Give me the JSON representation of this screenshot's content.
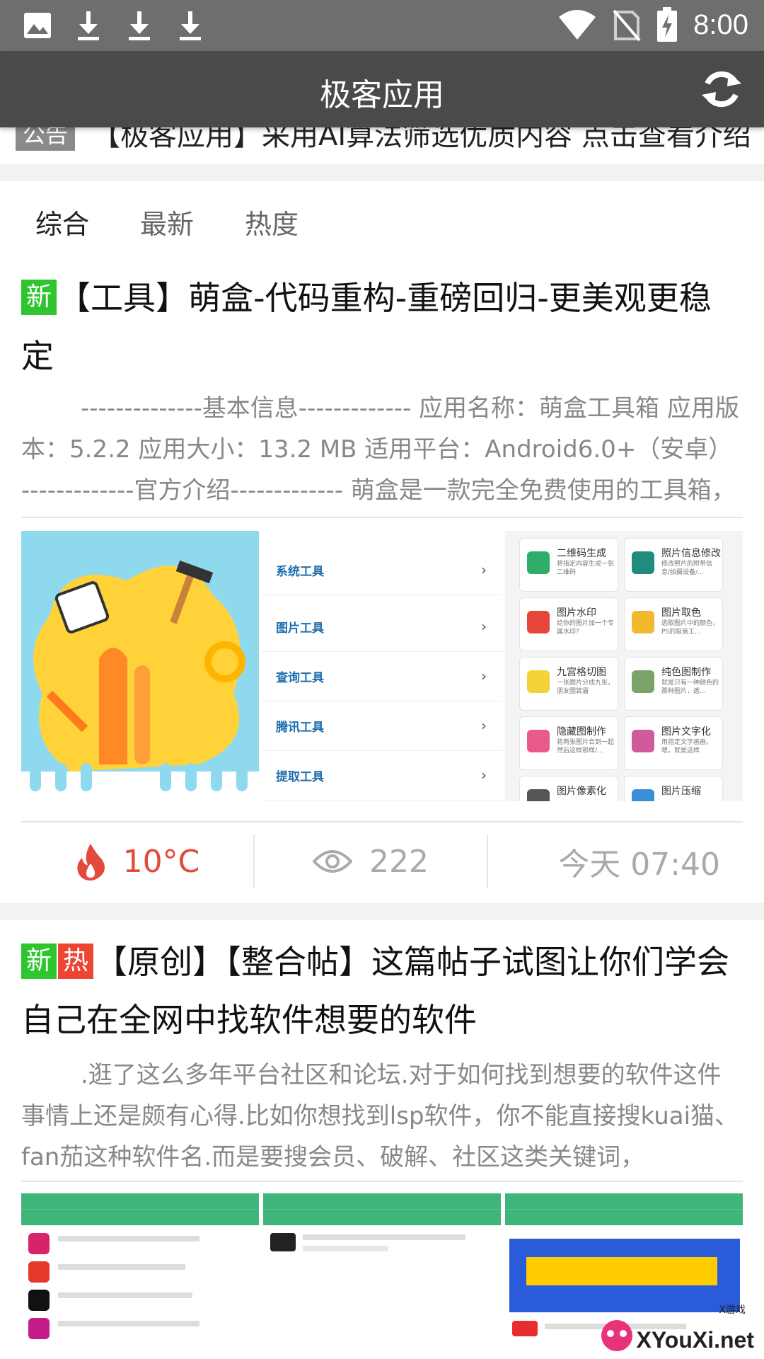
{
  "status_bar": {
    "time": "8:00",
    "left_icons": [
      "image-icon",
      "download-icon",
      "download-icon",
      "download-icon"
    ],
    "right_icons": [
      "wifi-icon",
      "no-sim-icon",
      "battery-charging-icon"
    ]
  },
  "app_bar": {
    "title": "极客应用",
    "refresh_icon": "refresh-icon"
  },
  "notice": {
    "tag": "公告",
    "text": "【极客应用】采用AI算法筛选优质内容 点击查看介绍"
  },
  "tabs": [
    {
      "label": "综合",
      "active": true
    },
    {
      "label": "最新",
      "active": false
    },
    {
      "label": "热度",
      "active": false
    }
  ],
  "posts": [
    {
      "badges": [
        "新"
      ],
      "title": "【工具】萌盒-代码重构-重磅回归-更美观更稳定",
      "excerpt": "--------------基本信息------------- 应用名称：萌盒工具箱 应用版本：5.2.2 应用大小：13.2 MB 适用平台：Android6.0+（安卓） -------------官方介绍------------- 萌盒是一款完全免费使用的工具箱，拥有上百个实用功能，体积小巧无广告，让你的手机更加好用",
      "screenshot_categories": [
        "系统工具",
        "图片工具",
        "查询工具",
        "腾讯工具",
        "提取工具"
      ],
      "screenshot_tools": [
        {
          "title": "二维码生成",
          "desc": "将指定内容生成一张二维码"
        },
        {
          "title": "照片信息修改",
          "desc": "修改照片的附带信息/拍摄设备/..."
        },
        {
          "title": "图片水印",
          "desc": "给你的图片加一个专属水印?"
        },
        {
          "title": "图片取色",
          "desc": "选取图片中的颜色，PS的吸管工..."
        },
        {
          "title": "九宫格切图",
          "desc": "一张图片分成九张，朋友圈装逼"
        },
        {
          "title": "纯色图制作",
          "desc": "就是只有一种颜色的那种图片，透..."
        },
        {
          "title": "隐藏图制作",
          "desc": "将两张图片合到一起然后这样那样/..."
        },
        {
          "title": "图片文字化",
          "desc": "用指定文字画画，嗯，就是这样"
        },
        {
          "title": "图片像素化",
          "desc": ""
        },
        {
          "title": "图片压缩",
          "desc": ""
        }
      ],
      "heat": "10°C",
      "views": "222",
      "time": "今天 07:40"
    },
    {
      "badges": [
        "新",
        "热"
      ],
      "title": "【原创】【整合帖】这篇帖子试图让你们学会自己在全网中找软件想要的软件",
      "excerpt": ".逛了这么多年平台社区和论坛.对于如何找到想要的软件这件事情上还是颇有心得.比如你想找到lsp软件，你不能直接搜kuai猫、fan茄这种软件名.而是要搜会员、破解、社区这类关键词，"
    }
  ],
  "watermark": {
    "text": "XYouXi.net",
    "small": "X游戏"
  },
  "colors": {
    "status_bar": "#6e6e6e",
    "app_bar": "#4a4a4a",
    "badge_new": "#2fc52f",
    "badge_hot": "#ee4433",
    "heat": "#e34a3a"
  }
}
